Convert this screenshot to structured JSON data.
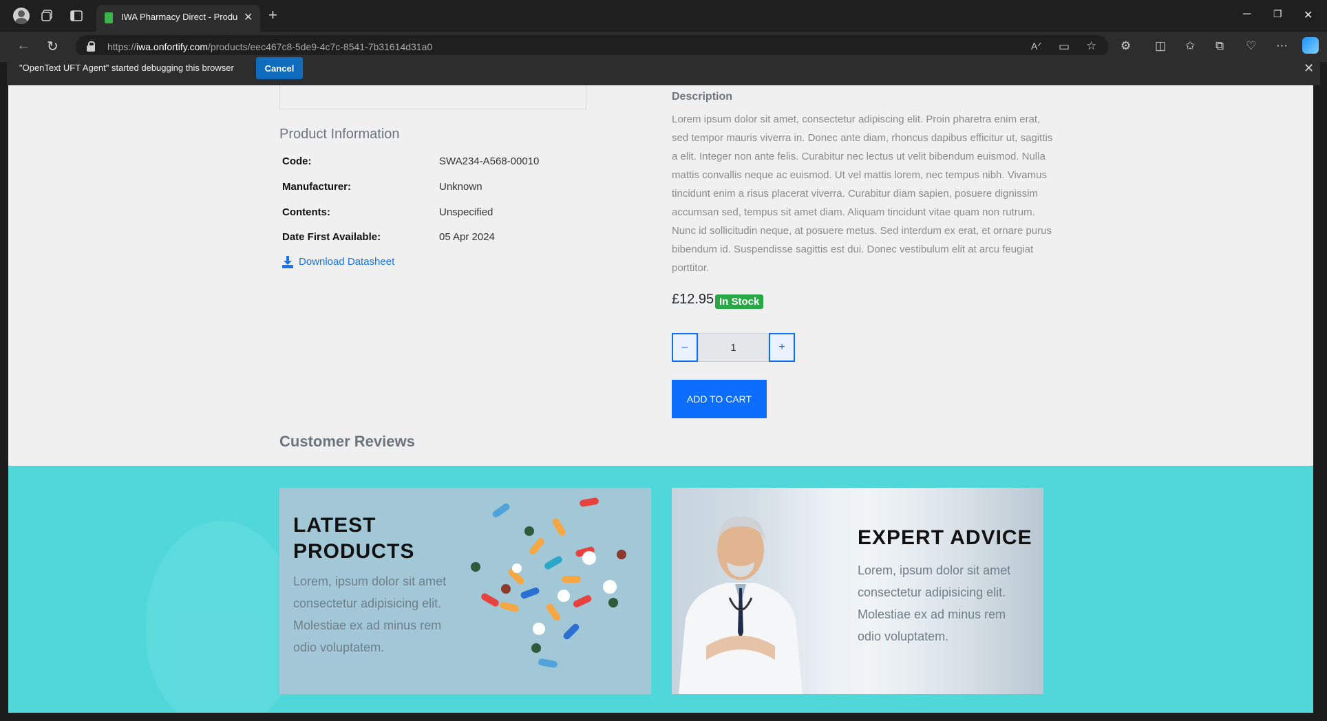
{
  "browser": {
    "tab_title": "IWA Pharmacy Direct - Product :",
    "url_domain": "iwa.onfortify.com",
    "url_prefix": "https://",
    "url_path": "/products/eec467c8-5de9-4c7c-8541-7b31614d31a0",
    "icons": [
      "profile-avatar",
      "workspaces-icon",
      "tab-actions-icon",
      "new-tab-icon",
      "back-icon",
      "refresh-icon",
      "lock-icon",
      "read-aloud-icon",
      "immersive-reader-icon",
      "favorite-star-icon",
      "extensions-icon",
      "split-screen-icon",
      "favorites-icon",
      "collections-icon",
      "browser-essentials-icon",
      "more-icon",
      "copilot-icon"
    ]
  },
  "infobar": {
    "message": "\"OpenText UFT Agent\" started debugging this browser",
    "cancel_label": "Cancel"
  },
  "product_info": {
    "heading": "Product Information",
    "rows": [
      {
        "label": "Code:",
        "value": "SWA234-A568-00010"
      },
      {
        "label": "Manufacturer:",
        "value": "Unknown"
      },
      {
        "label": "Contents:",
        "value": "Unspecified"
      },
      {
        "label": "Date First Available:",
        "value": "05 Apr 2024"
      }
    ],
    "download_label": "Download Datasheet"
  },
  "description": {
    "heading": "Description",
    "text": "Lorem ipsum dolor sit amet, consectetur adipiscing elit. Proin pharetra enim erat, sed tempor mauris viverra in. Donec ante diam, rhoncus dapibus efficitur ut, sagittis a elit. Integer non ante felis. Curabitur nec lectus ut velit bibendum euismod. Nulla mattis convallis neque ac euismod. Ut vel mattis lorem, nec tempus nibh. Vivamus tincidunt enim a risus placerat viverra. Curabitur diam sapien, posuere dignissim accumsan sed, tempus sit amet diam. Aliquam tincidunt vitae quam non rutrum. Nunc id sollicitudin neque, at posuere metus. Sed interdum ex erat, et ornare purus bibendum id. Suspendisse sagittis est dui. Donec vestibulum elit at arcu feugiat porttitor."
  },
  "purchase": {
    "price": "£12.95",
    "stock_badge": "In Stock",
    "quantity": "1",
    "minus_label": "–",
    "plus_label": "+",
    "add_to_cart_label": "ADD TO CART"
  },
  "reviews": {
    "heading": "Customer Reviews"
  },
  "banners": {
    "latest": {
      "title_line1": "LATEST",
      "title_line2": "PRODUCTS",
      "text": "Lorem, ipsum dolor sit amet consectetur adipisicing elit. Molestiae ex ad minus rem odio voluptatem."
    },
    "expert": {
      "title": "EXPERT ADVICE",
      "text": "Lorem, ipsum dolor sit amet consectetur adipisicing elit. Molestiae ex ad minus rem odio voluptatem."
    }
  },
  "colors": {
    "accent": "#0d6efd",
    "stock": "#28a745",
    "banner": "#50d7da"
  }
}
